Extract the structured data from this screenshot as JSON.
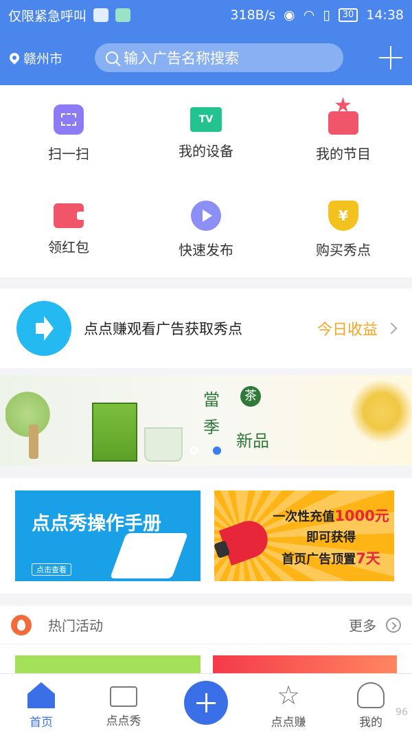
{
  "status_bar": {
    "carrier": "仅限紧急呼叫",
    "speed": "318B/s",
    "battery": "30",
    "time": "14:38"
  },
  "header": {
    "location": "赣州市",
    "search_placeholder": "输入广告名称搜索"
  },
  "menu": {
    "items": [
      {
        "label": "扫一扫",
        "icon": "scan-icon"
      },
      {
        "label": "我的设备",
        "icon": "tv-icon",
        "badge": "TV"
      },
      {
        "label": "我的节目",
        "icon": "program-star-icon"
      },
      {
        "label": "领红包",
        "icon": "wallet-icon"
      },
      {
        "label": "快速发布",
        "icon": "play-icon"
      },
      {
        "label": "购买秀点",
        "icon": "yen-coin-icon",
        "badge": "¥"
      }
    ]
  },
  "earn": {
    "text": "点点赚观看广告获取秀点",
    "today_label": "今日收益"
  },
  "banner": {
    "title_chars": [
      "當",
      "茶",
      "季",
      "新品"
    ]
  },
  "promos": {
    "manual": {
      "title": "点点秀操作手册",
      "link": "点击查看"
    },
    "recharge": {
      "line1": "一次性充值",
      "amount": "1000元",
      "line2": "即可获得",
      "line3": "首页广告顶置",
      "days": "7天"
    }
  },
  "hot": {
    "title": "热门活动",
    "more": "更多"
  },
  "tabbar": {
    "home": "首页",
    "show": "点点秀",
    "earn": "点点赚",
    "mine": "我的",
    "watermark": "96"
  },
  "colors": {
    "brand_blue": "#4a86ec",
    "accent_orange": "#f5a623",
    "tab_active": "#3a6fe8"
  }
}
